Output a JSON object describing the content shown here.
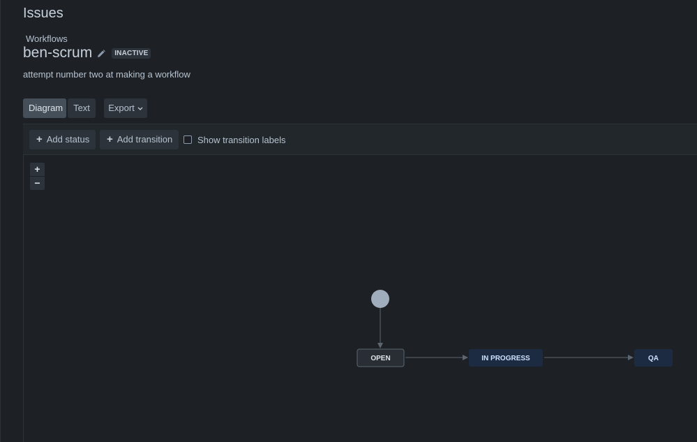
{
  "header": {
    "title": "Issues",
    "breadcrumb": "Workflows",
    "workflow_name": "ben-scrum",
    "status_badge": "INACTIVE",
    "description": "attempt number two at making a workflow"
  },
  "view_tabs": [
    {
      "label": "Diagram",
      "active": true
    },
    {
      "label": "Text",
      "active": false
    }
  ],
  "export_label": "Export",
  "toolbar": {
    "add_status_label": "Add status",
    "add_transition_label": "Add transition",
    "show_labels_label": "Show transition labels",
    "show_labels_checked": false
  },
  "zoom": {
    "in_label": "+",
    "out_label": "−"
  },
  "workflow": {
    "statuses": [
      {
        "label": "OPEN",
        "category": "to-do"
      },
      {
        "label": "IN PROGRESS",
        "category": "in-progress"
      },
      {
        "label": "QA",
        "category": "in-progress"
      }
    ],
    "transitions": [
      "start → OPEN",
      "OPEN → IN PROGRESS",
      "IN PROGRESS → QA"
    ]
  },
  "colors": {
    "background": "#1d2125",
    "todo_status": "#282e33",
    "in_progress_status": "#1c2b42",
    "start_node": "#8c9bab"
  }
}
